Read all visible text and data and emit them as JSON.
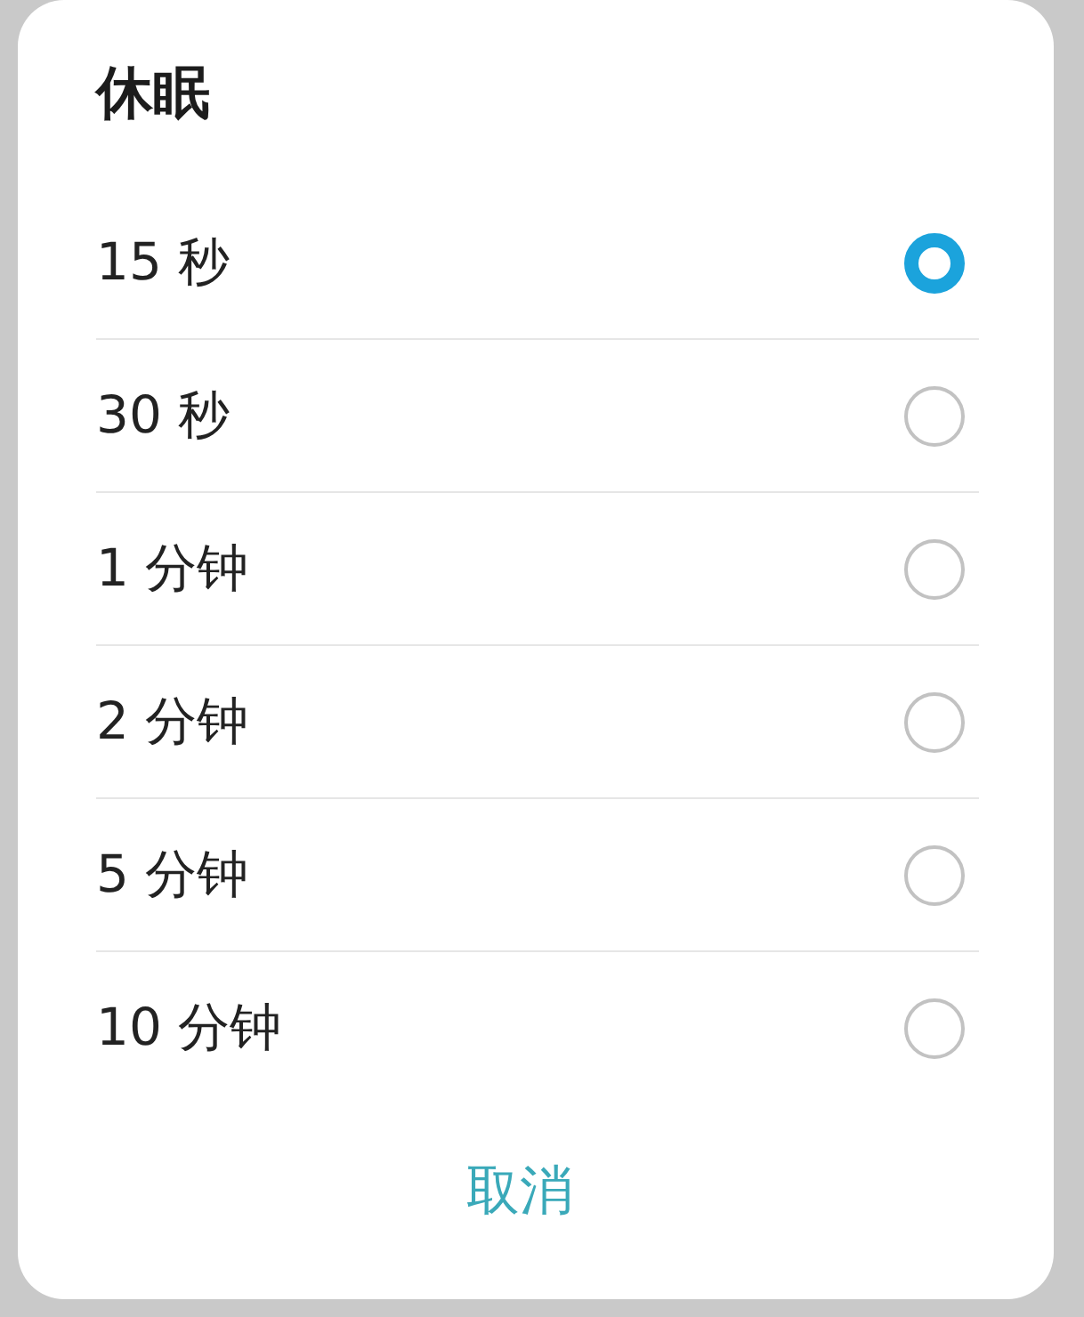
{
  "dialog": {
    "title": "休眠",
    "options": [
      {
        "label": "15 秒",
        "selected": true
      },
      {
        "label": "30 秒",
        "selected": false
      },
      {
        "label": "1 分钟",
        "selected": false
      },
      {
        "label": "2 分钟",
        "selected": false
      },
      {
        "label": "5 分钟",
        "selected": false
      },
      {
        "label": "10 分钟",
        "selected": false
      }
    ],
    "buttons": [
      {
        "label": "取消"
      }
    ]
  }
}
